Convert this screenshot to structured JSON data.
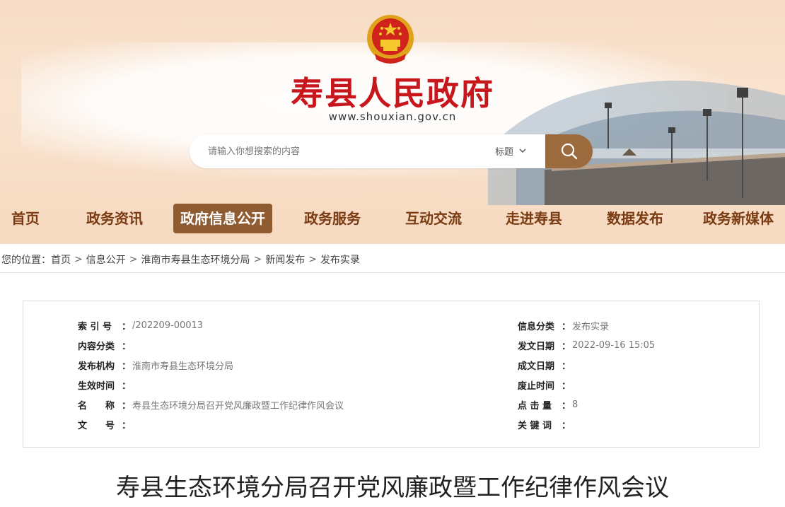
{
  "header": {
    "site_title": "寿县人民政府",
    "site_url": "www.shouxian.gov.cn",
    "brand_color": "#c8161d",
    "accent_color": "#8f5b31"
  },
  "search": {
    "placeholder": "请输入你想搜索的内容",
    "type_label": "标题",
    "icon": "search-icon"
  },
  "nav": {
    "items": [
      {
        "label": "首页"
      },
      {
        "label": "政务资讯"
      },
      {
        "label": "政府信息公开",
        "active": true
      },
      {
        "label": "政务服务"
      },
      {
        "label": "互动交流"
      },
      {
        "label": "走进寿县"
      },
      {
        "label": "数据发布"
      },
      {
        "label": "政务新媒体"
      }
    ]
  },
  "breadcrumb": {
    "prefix": "您的位置：",
    "items": [
      "首页",
      "信息公开",
      "淮南市寿县生态环境分局",
      "新闻发布",
      "发布实录"
    ],
    "separator": ">"
  },
  "meta": {
    "left": [
      {
        "label": "索 引 号",
        "value": "/202209-00013"
      },
      {
        "label": "内容分类",
        "value": ""
      },
      {
        "label": "发布机构",
        "value": "淮南市寿县生态环境分局"
      },
      {
        "label": "生效时间",
        "value": ""
      },
      {
        "label": "名　　称",
        "value": "寿县生态环境分局召开党风廉政暨工作纪律作风会议"
      },
      {
        "label": "文　　号",
        "value": ""
      }
    ],
    "right": [
      {
        "label": "信息分类",
        "value": "发布实录"
      },
      {
        "label": "发文日期",
        "value": "2022-09-16 15:05"
      },
      {
        "label": "成文日期",
        "value": ""
      },
      {
        "label": "废止时间",
        "value": ""
      },
      {
        "label": "点 击 量",
        "value": "8"
      },
      {
        "label": "关 键 词",
        "value": ""
      }
    ],
    "colon": "："
  },
  "article": {
    "title": "寿县生态环境分局召开党风廉政暨工作纪律作风会议"
  }
}
